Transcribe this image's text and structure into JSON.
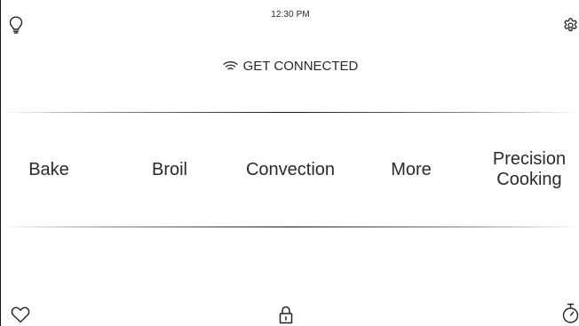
{
  "status_bar": {
    "time": "12:30 PM",
    "left_icon": "lightbulb-icon",
    "right_icon": "gear-icon"
  },
  "connect": {
    "label": "GET CONNECTED",
    "icon": "wifi-icon"
  },
  "modes": {
    "items": [
      {
        "label": "Bake"
      },
      {
        "label": "Broil"
      },
      {
        "label": "Convection"
      },
      {
        "label": "More"
      },
      {
        "label_line1": "Precision",
        "label_line2": "Cooking"
      }
    ]
  },
  "bottom_bar": {
    "left_icon": "heart-icon",
    "center_icon": "lock-icon",
    "right_icon": "timer-icon"
  },
  "colors": {
    "background": "#ffffff",
    "text": "#2a2a2a",
    "divider": "#1a1a1a"
  }
}
